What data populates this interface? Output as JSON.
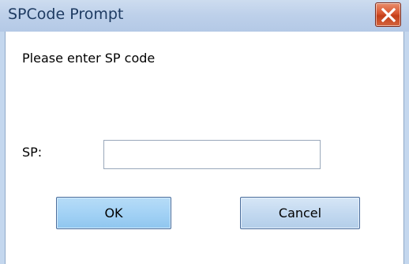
{
  "dialog": {
    "title": "SPCode Prompt",
    "instruction": "Please enter SP code",
    "sp_label": "SP:",
    "sp_value": "",
    "ok_label": "OK",
    "cancel_label": "Cancel",
    "close_icon": "close-icon"
  },
  "colors": {
    "titlebar": "#c4d7ee",
    "close_button": "#d4552f",
    "ok_button": "#a3d2f5",
    "cancel_button": "#c3d9f0"
  }
}
